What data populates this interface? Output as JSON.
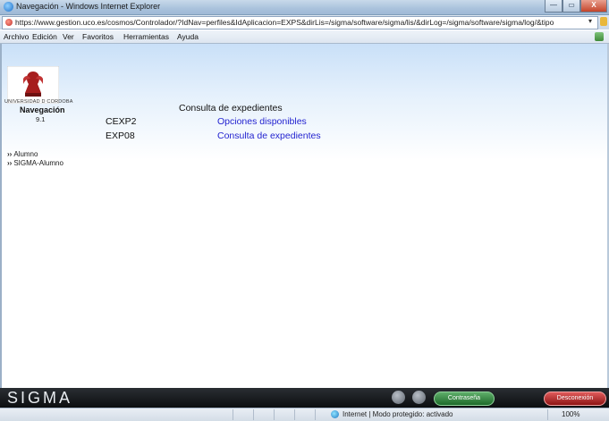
{
  "window": {
    "title": "Navegación - Windows Internet Explorer",
    "minimize": "—",
    "maximize": "▭",
    "close": "X"
  },
  "address": {
    "url": "https://www.gestion.uco.es/cosmos/Controlador/?IdNav=perfiles&IdAplicacion=EXPS&dirLis=/sigma/software/sigma/lis/&dirLog=/sigma/software/sigma/log/&tipo",
    "dropdown": "▾"
  },
  "menu": {
    "archivo": "Archivo",
    "edicion": "Edición",
    "ver": "Ver",
    "favoritos": "Favoritos",
    "herramientas": "Herramientas",
    "ayuda": "Ayuda"
  },
  "sidebar": {
    "logo_text": "UNIVERSIDAD D CORDOBA",
    "heading": "Navegación",
    "version": "9.1",
    "items": [
      {
        "label": "Alumno"
      },
      {
        "label": "SIGMA-Alumno"
      }
    ]
  },
  "main": {
    "title": "Consulta de expedientes",
    "rows": [
      {
        "code": "CEXP2",
        "link": "Opciones disponibles"
      },
      {
        "code": "EXP08",
        "link": "Consulta de expedientes"
      }
    ]
  },
  "sigma_bar": {
    "logo": "SIGMA",
    "password_button": "Contraseña",
    "logout_button": "Desconexión"
  },
  "status": {
    "zone": "Internet | Modo protegido: activado",
    "zoom": "100%"
  }
}
